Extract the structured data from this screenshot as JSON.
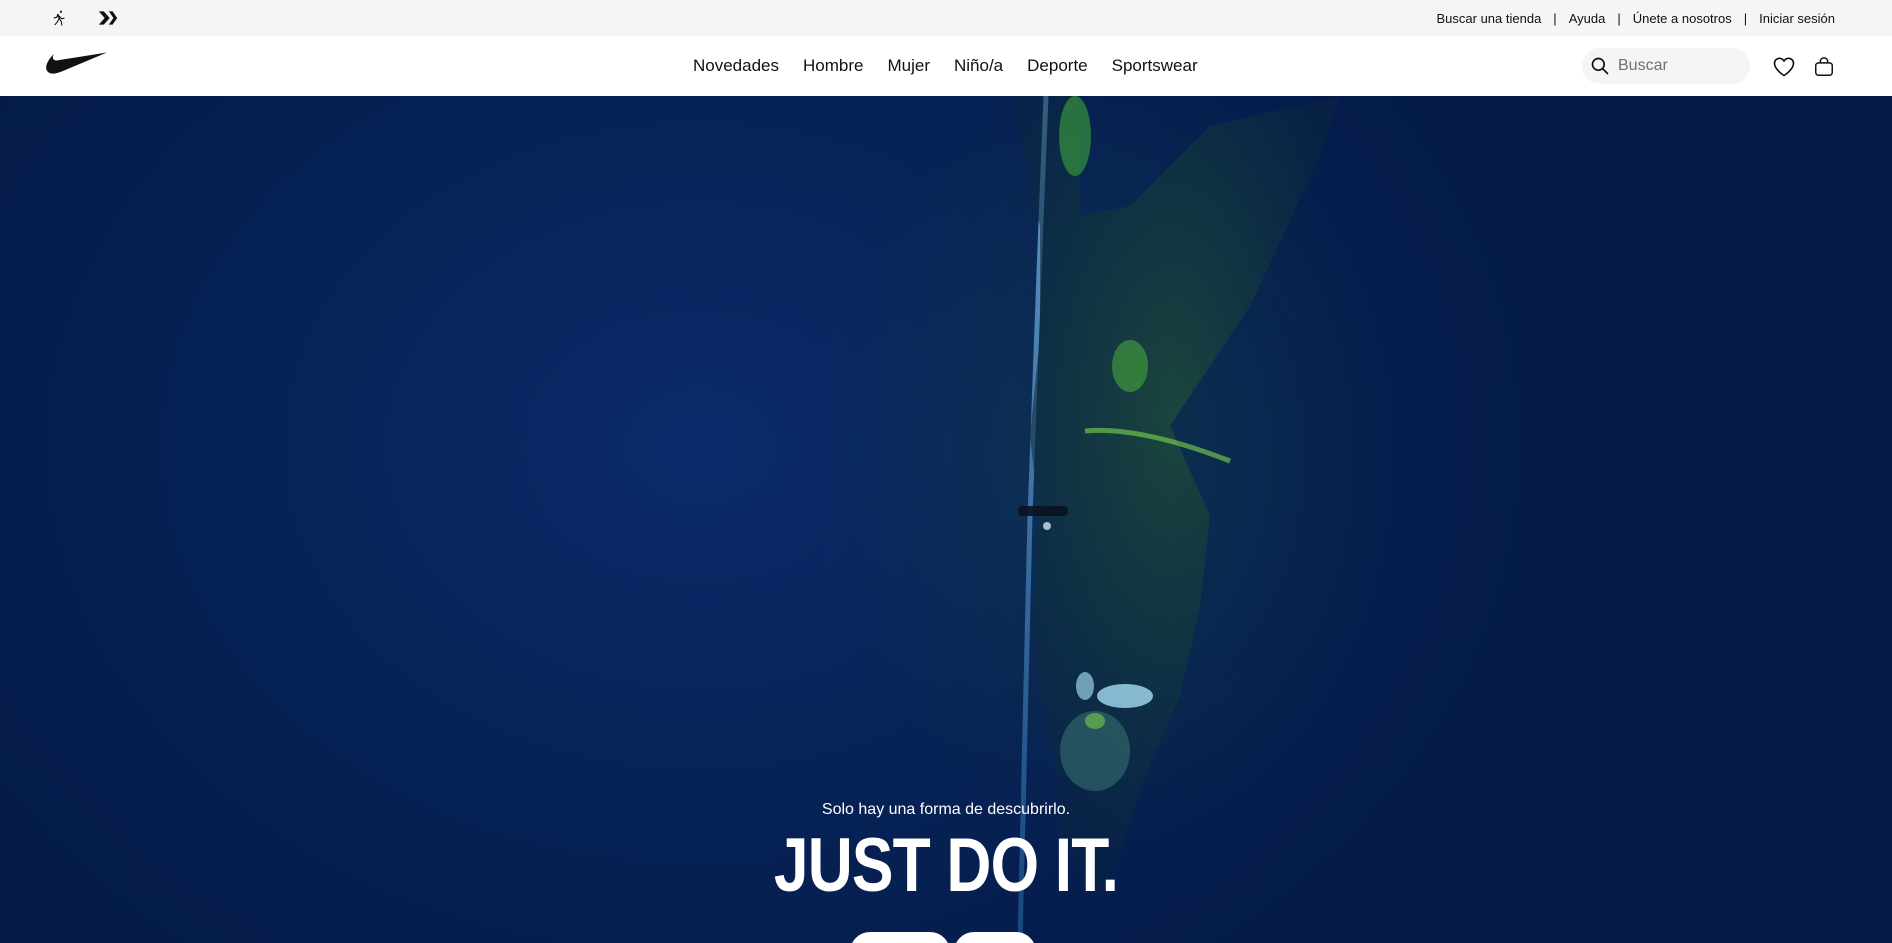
{
  "utility_bar": {
    "links": [
      {
        "label": "Buscar una tienda"
      },
      {
        "label": "Ayuda"
      },
      {
        "label": "Únete a nosotros"
      },
      {
        "label": "Iniciar sesión"
      }
    ],
    "separator": "|",
    "brand_icons": [
      "jordan-jumpman-icon",
      "converse-chevron-icon"
    ]
  },
  "nav": {
    "logo_icon": "nike-swoosh-icon",
    "menu": [
      {
        "label": "Novedades"
      },
      {
        "label": "Hombre"
      },
      {
        "label": "Mujer"
      },
      {
        "label": "Niño/a"
      },
      {
        "label": "Deporte"
      },
      {
        "label": "Sportswear"
      }
    ],
    "search": {
      "placeholder": "Buscar",
      "value": ""
    },
    "icons": [
      "search-icon",
      "heart-icon",
      "bag-icon"
    ]
  },
  "hero": {
    "subtitle": "Solo hay una forma de descubrirlo.",
    "title": "JUST DO IT.",
    "background_color": "#072357",
    "buttons": [
      {
        "label": ""
      },
      {
        "label": ""
      }
    ]
  }
}
